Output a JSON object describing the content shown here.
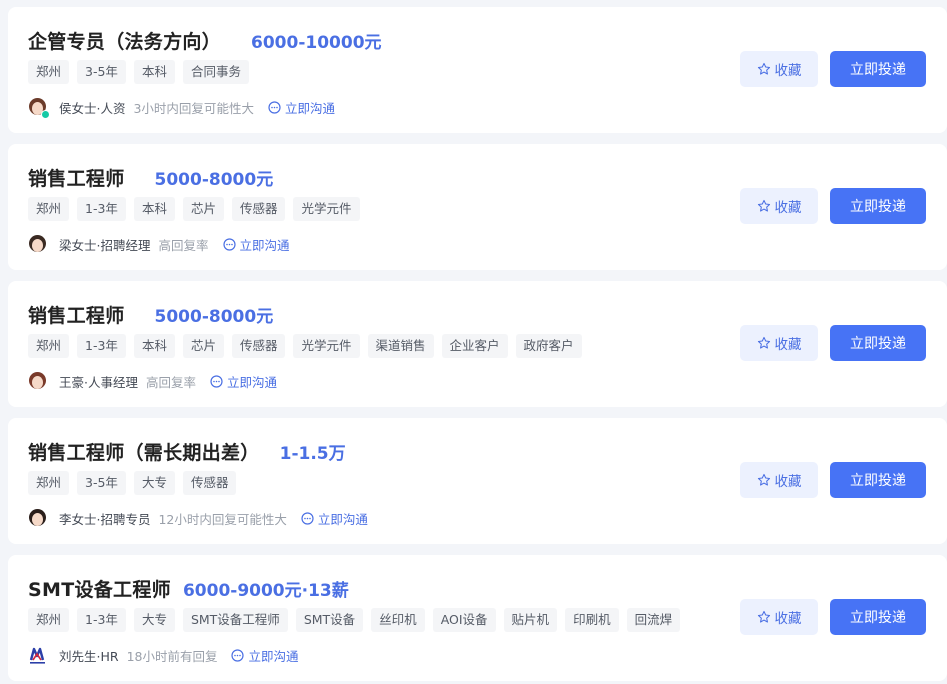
{
  "jobs": [
    {
      "title": "企管专员（法务方向）",
      "salary": "6000-10000元",
      "tags": [
        "郑州",
        "3-5年",
        "本科",
        "合同事务"
      ],
      "recruiter": "侯女士·人资",
      "status": "3小时内回复可能性大",
      "chat_label": "立即沟通",
      "fav_label": "收藏",
      "apply_label": "立即投递"
    },
    {
      "title": "销售工程师",
      "salary": "5000-8000元",
      "tags": [
        "郑州",
        "1-3年",
        "本科",
        "芯片",
        "传感器",
        "光学元件"
      ],
      "recruiter": "梁女士·招聘经理",
      "status": "高回复率",
      "chat_label": "立即沟通",
      "fav_label": "收藏",
      "apply_label": "立即投递"
    },
    {
      "title": "销售工程师",
      "salary": "5000-8000元",
      "tags": [
        "郑州",
        "1-3年",
        "本科",
        "芯片",
        "传感器",
        "光学元件",
        "渠道销售",
        "企业客户",
        "政府客户"
      ],
      "recruiter": "王豪·人事经理",
      "status": "高回复率",
      "chat_label": "立即沟通",
      "fav_label": "收藏",
      "apply_label": "立即投递"
    },
    {
      "title": "销售工程师（需长期出差）",
      "salary": "1-1.5万",
      "tags": [
        "郑州",
        "3-5年",
        "大专",
        "传感器"
      ],
      "recruiter": "李女士·招聘专员",
      "status": "12小时内回复可能性大",
      "chat_label": "立即沟通",
      "fav_label": "收藏",
      "apply_label": "立即投递"
    },
    {
      "title": "SMT设备工程师",
      "salary": "6000-9000元·13薪",
      "tags": [
        "郑州",
        "1-3年",
        "大专",
        "SMT设备工程师",
        "SMT设备",
        "丝印机",
        "AOI设备",
        "贴片机",
        "印刷机",
        "回流焊"
      ],
      "recruiter": "刘先生·HR",
      "status": "18小时前有回复",
      "chat_label": "立即沟通",
      "fav_label": "收藏",
      "apply_label": "立即投递"
    }
  ],
  "colors": {
    "accent": "#4773f5",
    "salary": "#4a6fe3",
    "online_dot": "#16c9a5"
  }
}
